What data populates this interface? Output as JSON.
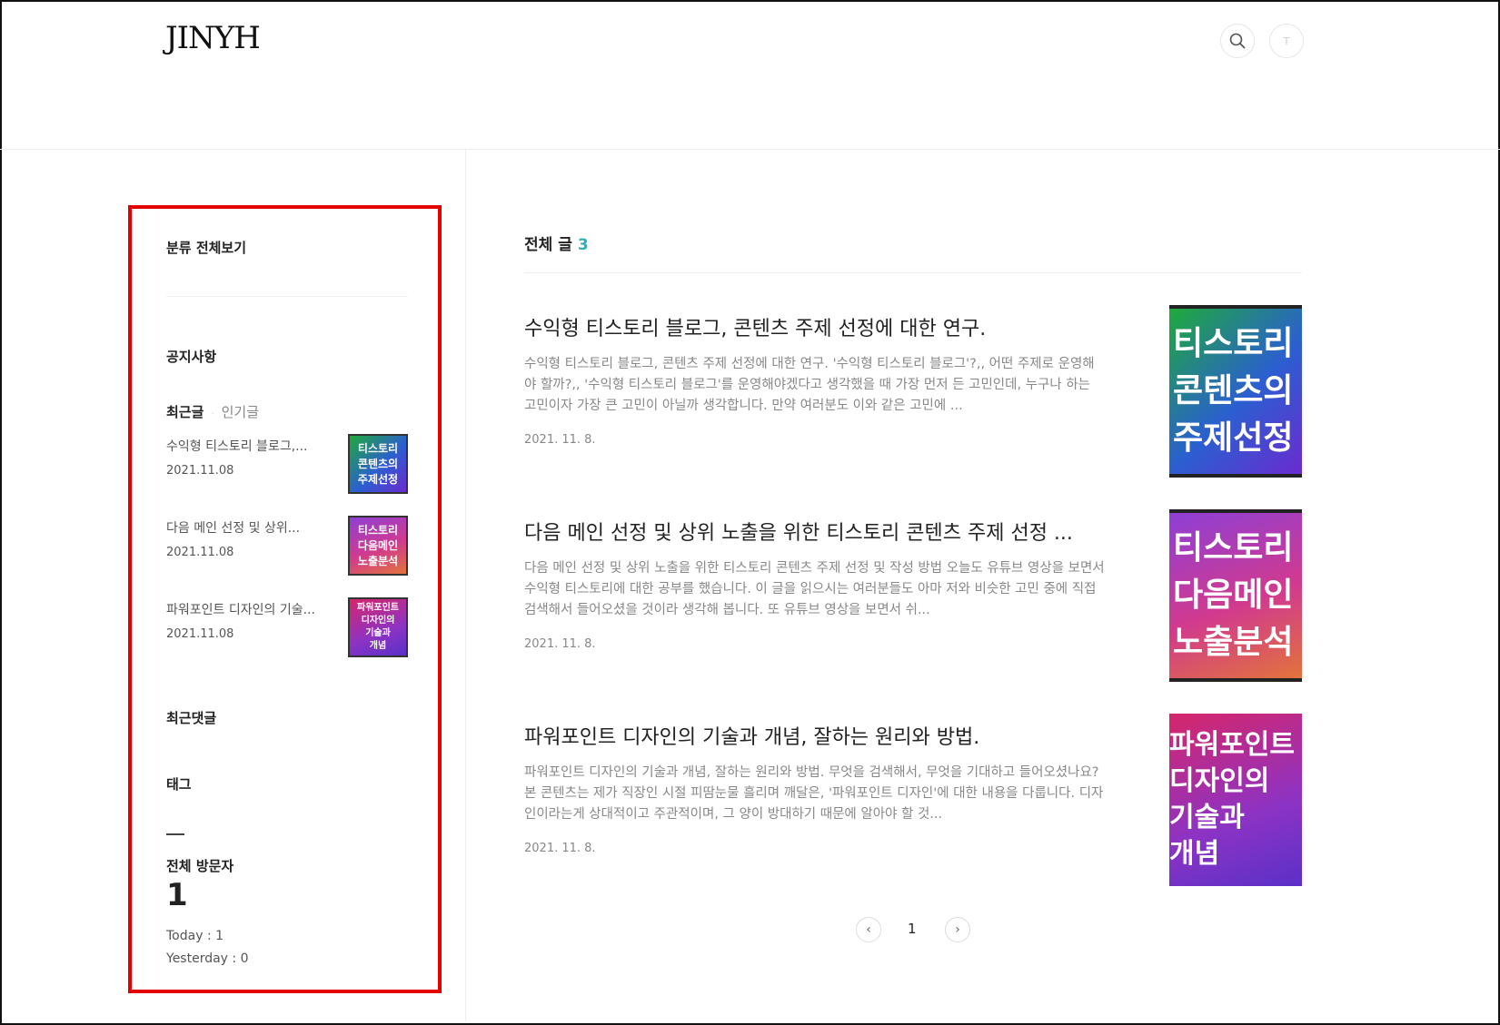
{
  "header": {
    "logo": "JINYH",
    "profile_initial": "T"
  },
  "sidebar": {
    "category_all": "분류 전체보기",
    "notice": "공지사항",
    "tabs": {
      "recent": "최근글",
      "popular": "인기글"
    },
    "recent_posts": [
      {
        "title": "수익형 티스토리 블로그,...",
        "date": "2021.11.08",
        "thumb": [
          "티스토리",
          "콘텐츠의",
          "주제선정"
        ]
      },
      {
        "title": "다음 메인 선정 및 상위...",
        "date": "2021.11.08",
        "thumb": [
          "티스토리",
          "다음메인",
          "노출분석"
        ]
      },
      {
        "title": "파워포인트 디자인의 기술...",
        "date": "2021.11.08",
        "thumb": [
          "파워포인트",
          "디자인의",
          "기술과",
          "개념"
        ]
      }
    ],
    "recent_comments": "최근댓글",
    "tags": "태그",
    "visitors_label": "전체 방문자",
    "visitors_total": "1",
    "today": "Today : 1",
    "yesterday": "Yesterday : 0"
  },
  "main": {
    "section_title": "전체 글",
    "count": "3",
    "posts": [
      {
        "title": "수익형 티스토리 블로그, 콘텐츠 주제 선정에 대한 연구.",
        "summary": "수익형 티스토리 블로그, 콘텐츠 주제 선정에 대한 연구. '수익형 티스토리 블로그'?,, 어떤 주제로 운영해야 할까?,, '수익형 티스토리 블로그'를 운영해야겠다고 생각했을 때 가장 먼저 든 고민인데, 누구나 하는 고민이자 가장 큰 고민이 아닐까 생각합니다. 만약 여러분도 이와 같은 고민에 ...",
        "date": "2021. 11. 8.",
        "thumb": [
          "티스토리",
          "콘텐츠의",
          "주제선정"
        ]
      },
      {
        "title": "다음 메인 선정 및 상위 노출을 위한 티스토리 콘텐츠 주제 선정 ...",
        "summary": "다음 메인 선정 및 상위 노출을 위한 티스토리 콘텐츠 주제 선정 및 작성 방법 오늘도 유튜브 영상을 보면서 수익형 티스토리에 대한 공부를 했습니다. 이 글을 읽으시는 여러분들도 아마 저와 비슷한 고민 중에 직접 검색해서 들어오셨을 것이라 생각해 봅니다. 또 유튜브 영상을 보면서 쉬...",
        "date": "2021. 11. 8.",
        "thumb": [
          "티스토리",
          "다음메인",
          "노출분석"
        ]
      },
      {
        "title": "파워포인트 디자인의 기술과 개념, 잘하는 원리와 방법.",
        "summary": "파워포인트 디자인의 기술과 개념, 잘하는 원리와 방법. 무엇을 검색해서, 무엇을 기대하고 들어오셨나요? 본 콘텐츠는 제가 직장인 시절 피땀눈물 흘리며 깨달은, '파워포인트 디자인'에 대한 내용을 다룹니다. 디자인이라는게 상대적이고 주관적이며, 그 양이 방대하기 때문에 알아야 할 것...",
        "date": "2021. 11. 8.",
        "thumb": [
          "파워포인트",
          "디자인의",
          "기술과",
          "개념"
        ]
      }
    ],
    "pagination": {
      "current": "1",
      "prev": "‹",
      "next": "›"
    }
  }
}
